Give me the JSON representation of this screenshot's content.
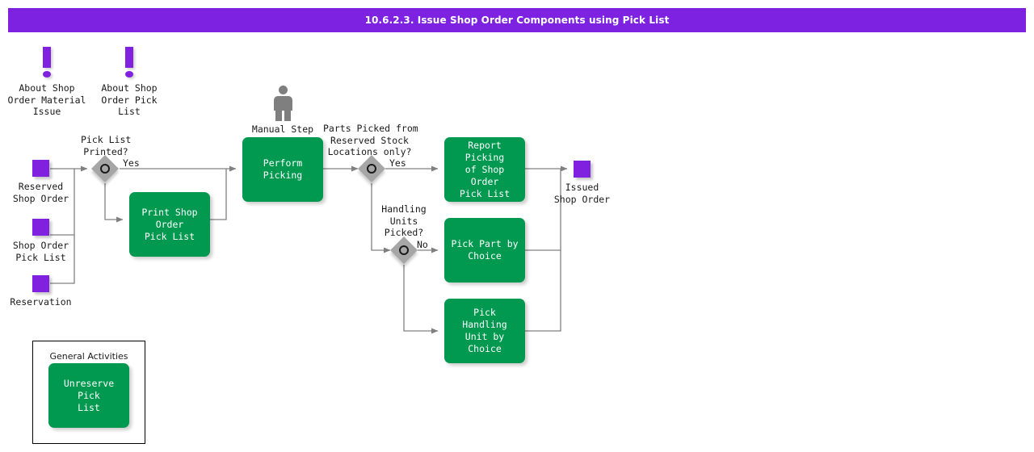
{
  "header": {
    "title": "10.6.2.3. Issue Shop Order Components using Pick List",
    "bar_color": "#7d22e0",
    "text_color": "#ffffff"
  },
  "palette": {
    "activity_green": "#00994f",
    "entity_purple": "#8021e0",
    "decision_gray": "#a6a6a6",
    "manual_step_gray": "#7f7f7f",
    "edge_gray": "#808080",
    "canvas_background": "#ffffff"
  },
  "notes": [
    {
      "id": "note-material-issue",
      "label": "About Shop\nOrder Material\nIssue",
      "icon": "exclamation-icon"
    },
    {
      "id": "note-pick-list",
      "label": "About Shop\nOrder Pick\nList",
      "icon": "exclamation-icon"
    }
  ],
  "entities": [
    {
      "id": "entity-reserved-shop-order",
      "label": "Reserved\nShop Order"
    },
    {
      "id": "entity-shop-order-pick-list",
      "label": "Shop Order\nPick List"
    },
    {
      "id": "entity-reservation",
      "label": "Reservation"
    },
    {
      "id": "entity-issued-shop-order",
      "label": "Issued\nShop Order"
    }
  ],
  "manual_step": {
    "id": "manual-step-perform-picking",
    "label": "Manual Step",
    "icon": "person-icon"
  },
  "decisions": [
    {
      "id": "decision-pick-list-printed",
      "label": "Pick List\nPrinted?",
      "branches": [
        "Yes"
      ]
    },
    {
      "id": "decision-parts-picked-reserved",
      "label": "Parts Picked from\nReserved Stock\nLocations only?",
      "branches": [
        "Yes"
      ]
    },
    {
      "id": "decision-handling-units-picked",
      "label": "Handling\nUnits\nPicked?",
      "branches": [
        "No"
      ]
    }
  ],
  "branch_labels": {
    "pick_list_printed_yes": "Yes",
    "parts_picked_yes": "Yes",
    "handling_units_no": "No"
  },
  "activities": [
    {
      "id": "activity-print-shop-order-pick-list",
      "label": "Print Shop Order\nPick List"
    },
    {
      "id": "activity-perform-picking",
      "label": "Perform Picking"
    },
    {
      "id": "activity-report-picking",
      "label": "Report Picking\nof Shop Order\nPick List"
    },
    {
      "id": "activity-pick-part-by-choice",
      "label": "Pick Part by\nChoice"
    },
    {
      "id": "activity-pick-handling-unit-by-choice",
      "label": "Pick Handling\nUnit by Choice"
    }
  ],
  "general_activities": {
    "title": "General Activities",
    "items": [
      {
        "id": "activity-unreserve-pick-list",
        "label": "Unreserve Pick\nList"
      }
    ]
  }
}
